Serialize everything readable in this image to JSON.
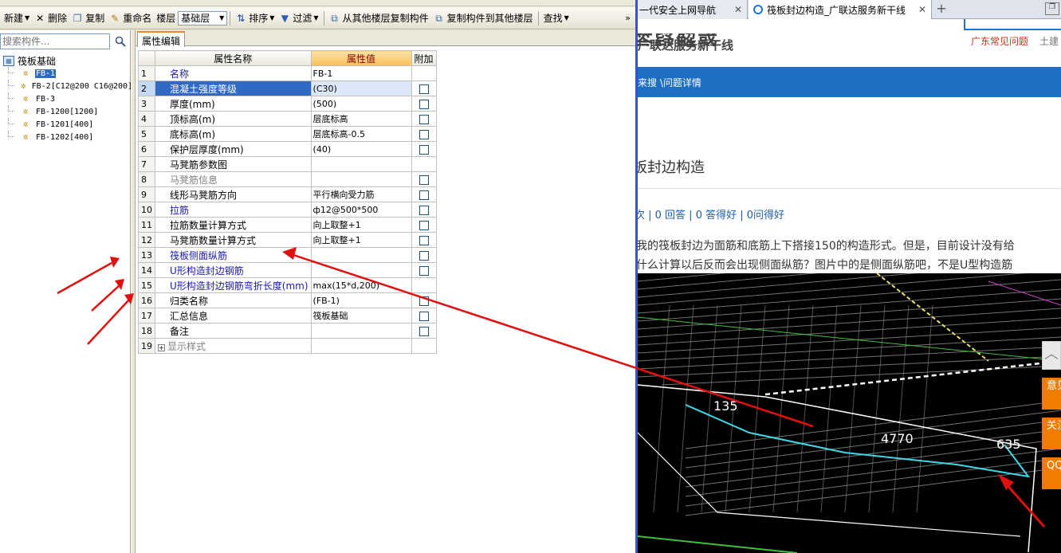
{
  "toolbar": {
    "new_label": "新建",
    "delete_label": "删除",
    "copy_label": "复制",
    "rename_label": "重命名",
    "floor_label": "楼层",
    "floor_value": "基础层",
    "sort_label": "排序",
    "filter_label": "过滤",
    "copy_from_other_label": "从其他楼层复制构件",
    "copy_to_other_label": "复制构件到其他楼层",
    "find_label": "查找"
  },
  "left_panel": {
    "search_placeholder": "搜索构件...",
    "tree_root": "筏板基础",
    "tree_items": [
      {
        "label": "FB-1"
      },
      {
        "label": "FB-2[C12@200 C16@200]"
      },
      {
        "label": "FB-3"
      },
      {
        "label": "FB-1200[1200]"
      },
      {
        "label": "FB-1201[400]"
      },
      {
        "label": "FB-1202[400]"
      }
    ]
  },
  "editor": {
    "tab_label": "属性编辑",
    "col_name": "属性名称",
    "col_value": "属性值",
    "col_extra": "附加",
    "rows": [
      {
        "num": "1",
        "name": "名称",
        "value": "FB-1"
      },
      {
        "num": "2",
        "name": "混凝土强度等级",
        "value": "(C30)"
      },
      {
        "num": "3",
        "name": "厚度(mm)",
        "value": "(500)"
      },
      {
        "num": "4",
        "name": "顶标高(m)",
        "value": "层底标高"
      },
      {
        "num": "5",
        "name": "底标高(m)",
        "value": "层底标高-0.5"
      },
      {
        "num": "6",
        "name": "保护层厚度(mm)",
        "value": "(40)"
      },
      {
        "num": "7",
        "name": "马凳筋参数图",
        "value": ""
      },
      {
        "num": "8",
        "name": "马凳筋信息",
        "value": ""
      },
      {
        "num": "9",
        "name": "线形马凳筋方向",
        "value": "平行横向受力筋"
      },
      {
        "num": "10",
        "name": "拉筋",
        "value": "ф12@500*500"
      },
      {
        "num": "11",
        "name": "拉筋数量计算方式",
        "value": "向上取整+1"
      },
      {
        "num": "12",
        "name": "马凳筋数量计算方式",
        "value": "向上取整+1"
      },
      {
        "num": "13",
        "name": "筏板侧面纵筋",
        "value": ""
      },
      {
        "num": "14",
        "name": "U形构造封边钢筋",
        "value": ""
      },
      {
        "num": "15",
        "name": "U形构造封边钢筋弯折长度(mm)",
        "value": "max(15*d,200)"
      },
      {
        "num": "16",
        "name": "归类名称",
        "value": "(FB-1)"
      },
      {
        "num": "17",
        "name": "汇总信息",
        "value": "筏板基础"
      },
      {
        "num": "18",
        "name": "备注",
        "value": ""
      },
      {
        "num": "19",
        "name": "显示样式",
        "value": ""
      }
    ]
  },
  "browser": {
    "tab1_label": "一代安全上网导航",
    "tab2_label": "筏板封边构造_广联达服务新干线",
    "logo_line1": "答疑解惑",
    "logo_line2": "广联达服务新干线",
    "header_link1": "广东常见问题",
    "header_link2": "土建",
    "nav_text": "来搜 \\问题详情",
    "question_title": "板封边构造",
    "stats": "次 | 0 回答 | 0 答得好 | 0问得好",
    "question_line1": "我的筏板封边为面筋和底筋上下搭接150的构造形式。但是，目前设计没有给",
    "question_line2": "什么计算以后反而会出现侧面纵筋？图片中的是侧面纵筋吧，不是U型构造筋",
    "cad_label_1": "135",
    "cad_label_2": "4770",
    "cad_label_3": "635",
    "side_btn1": "意见反馈",
    "side_btn2": "关注我们",
    "side_btn3": "QQ咨询"
  },
  "colors": {
    "accent_blue": "#1e6fc2",
    "selection": "#316ac5",
    "arrow_red": "#e01010",
    "side_orange": "#f07c00"
  }
}
